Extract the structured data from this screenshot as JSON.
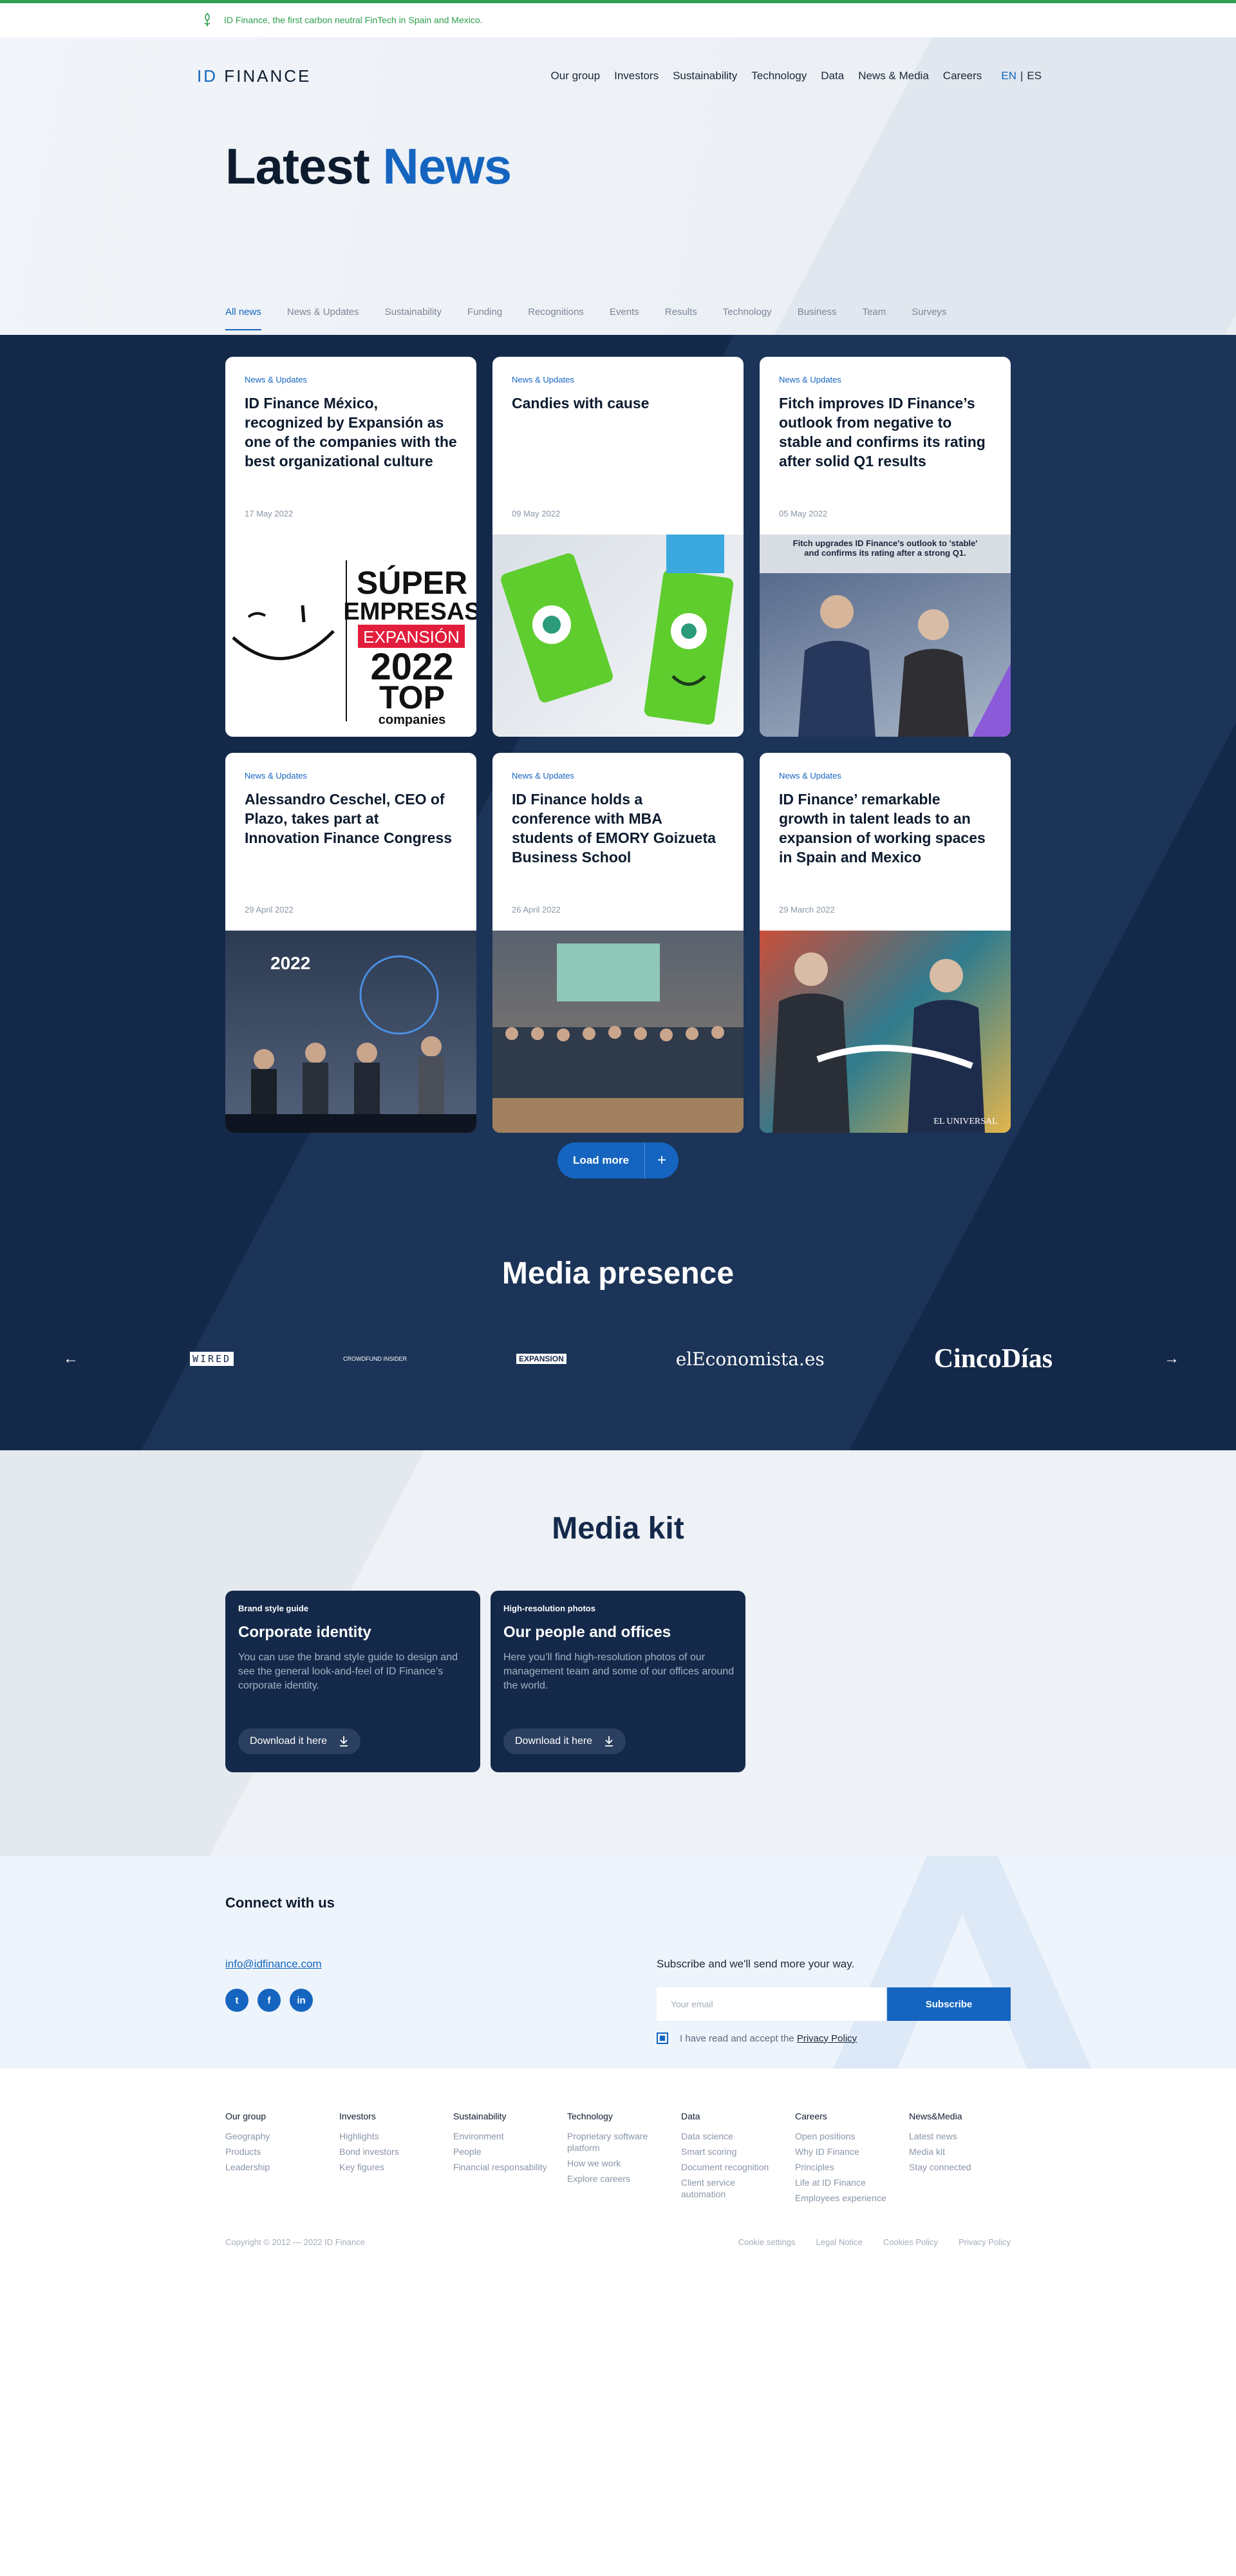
{
  "topbar": {
    "text": "ID Finance, the first carbon neutral FinTech in Spain and Mexico."
  },
  "header": {
    "logo_id": "ID",
    "logo_rest": "FINANCE",
    "nav": [
      "Our group",
      "Investors",
      "Sustainability",
      "Technology",
      "Data",
      "News & Media",
      "Careers"
    ],
    "lang_active": "EN",
    "lang_sep": "|",
    "lang_other": "ES"
  },
  "hero": {
    "title_black": "Latest",
    "title_blue": "News"
  },
  "filters": [
    "All news",
    "News & Updates",
    "Sustainability",
    "Funding",
    "Recognitions",
    "Events",
    "Results",
    "Technology",
    "Business",
    "Team",
    "Surveys"
  ],
  "cards": [
    {
      "tag": "News & Updates",
      "title": "ID Finance México, recognized by Expansión as one of the companies with the best organizational culture",
      "date": "17 May 2022"
    },
    {
      "tag": "News & Updates",
      "title": "Candies with cause",
      "date": "09 May 2022"
    },
    {
      "tag": "News & Updates",
      "title": "Fitch improves ID Finance’s outlook from negative to stable and confirms its rating after solid Q1 results",
      "date": "05 May 2022"
    },
    {
      "tag": "News & Updates",
      "title": "Alessandro Ceschel, CEO of Plazo, takes part at Innovation Finance Congress",
      "date": "29 April 2022"
    },
    {
      "tag": "News & Updates",
      "title": "ID Finance holds a conference with MBA students of EMORY Goizueta Business School",
      "date": "26 April 2022"
    },
    {
      "tag": "News & Updates",
      "title": "ID Finance’ remarkable growth in talent leads to an expansion of working spaces in Spain and Mexico",
      "date": "29 March 2022"
    }
  ],
  "card_images": {
    "super": {
      "l1": "SÚPER",
      "l2": "EMPRESAS",
      "l3": "EXPANSIÓN",
      "l4": "2022",
      "l5": "TOP",
      "l6": "companies"
    },
    "fitch_caption": "Fitch upgrades ID Finance's outlook to 'stable' and confirms its rating after a strong Q1.",
    "stage_text": "2022",
    "ribbon_text": "EL UNIVERSAL"
  },
  "loadmore": {
    "label": "Load more",
    "icon": "+"
  },
  "media": {
    "title": "Media presence",
    "logos": {
      "wired": "WIRED",
      "crowd": "CROWDFUND INSIDER",
      "exp": "EXPANSION",
      "eleco": "elEconomista.es",
      "cinco": "CincoDías"
    }
  },
  "kit": {
    "title": "Media kit",
    "cards": [
      {
        "tag": "Brand style guide",
        "title": "Corporate identity",
        "desc": "You can use the brand style guide to design and see the general look-and-feel of ID Finance’s corporate identity.",
        "button": "Download it here"
      },
      {
        "tag": "High-resolution photos",
        "title": "Our people and offices",
        "desc": "Here you’ll find high-resolution photos of our management team and some of our offices around the world.",
        "button": "Download it here"
      }
    ]
  },
  "connect": {
    "title": "Connect with us",
    "email": "info@idfinance.com",
    "social": [
      "twitter",
      "facebook",
      "linkedin"
    ],
    "subscribe_label": "Subscribe and we'll send more your way.",
    "input_placeholder": "Your email",
    "subscribe_button": "Subscribe",
    "consent_text": "I have read and accept the",
    "privacy_link": "Privacy Policy"
  },
  "footer": {
    "columns": [
      {
        "head": "Our group",
        "items": [
          "Geography",
          "Products",
          "Leadership"
        ]
      },
      {
        "head": "Investors",
        "items": [
          "Highlights",
          "Bond investors",
          "Key figures"
        ]
      },
      {
        "head": "Sustainability",
        "items": [
          "Environment",
          "People",
          "Financial responsability"
        ]
      },
      {
        "head": "Technology",
        "items": [
          "Proprietary software platform",
          "How we work",
          "Explore careers"
        ]
      },
      {
        "head": "Data",
        "items": [
          "Data science",
          "Smart scoring",
          "Document recognition",
          "Client service automation"
        ]
      },
      {
        "head": "Careers",
        "items": [
          "Open positions",
          "Why ID Finance",
          "Principles",
          "Life at ID Finance",
          "Employees experience"
        ]
      },
      {
        "head": "News&Media",
        "items": [
          "Latest news",
          "Media kit",
          "Stay connected"
        ]
      }
    ],
    "copyright": "Copyright © 2012 — 2022 ID Finance",
    "legal": [
      "Cookie settings",
      "Legal Notice",
      "Cookies Policy",
      "Privacy Policy"
    ]
  },
  "colors": {
    "brand_blue": "#1565c0",
    "navy": "#14294a",
    "green": "#2e9e4f"
  }
}
